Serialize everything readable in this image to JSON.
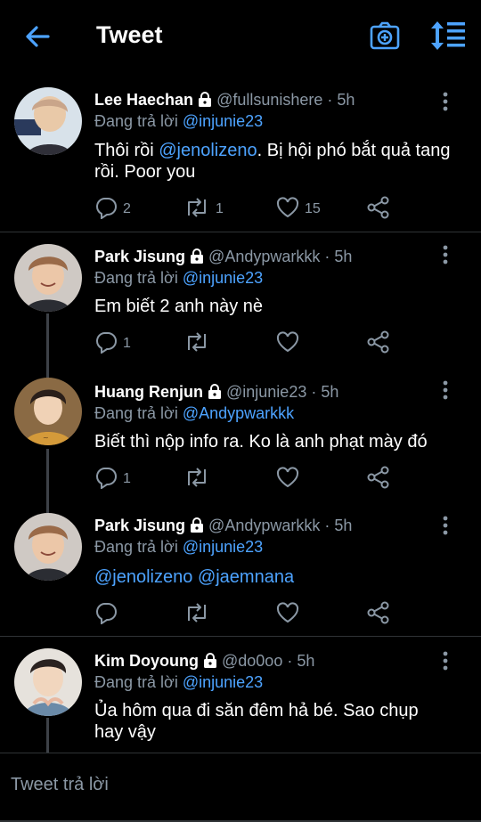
{
  "header": {
    "title": "Tweet"
  },
  "accent": "#4da3ff",
  "reply_bar": {
    "placeholder": "Tweet trả lời"
  },
  "tweets": [
    {
      "name": "Lee Haechan",
      "handle_time": "@fullsunishere · 5h",
      "reply_prefix": "Đang trả lời ",
      "reply_to": "@injunie23",
      "text_parts": [
        "Thôi rồi ",
        "@jenolizeno",
        ". Bị hội phó bắt quả tang rồi. Poor you"
      ],
      "replies": "2",
      "retweets": "1",
      "likes": "15"
    },
    {
      "name": "Park Jisung",
      "handle_time": "@Andypwarkkk · 5h",
      "reply_prefix": "Đang trả lời ",
      "reply_to": "@injunie23",
      "text": "Em biết 2 anh này nè",
      "replies": "1",
      "retweets": "",
      "likes": ""
    },
    {
      "name": "Huang Renjun",
      "handle_time": "@injunie23 · 5h",
      "reply_prefix": "Đang trả lời ",
      "reply_to": "@Andypwarkkk",
      "text": "Biết thì nộp info ra. Ko là anh phạt mày đó",
      "replies": "1",
      "retweets": "",
      "likes": ""
    },
    {
      "name": "Park Jisung",
      "handle_time": "@Andypwarkkk · 5h",
      "reply_prefix": "Đang trả lời ",
      "reply_to": "@injunie23",
      "text_parts": [
        "@jenolizeno",
        " ",
        "@jaemnana"
      ],
      "replies": "",
      "retweets": "",
      "likes": ""
    },
    {
      "name": "Kim Doyoung",
      "handle_time": "@do0oo · 5h",
      "reply_prefix": "Đang trả lời ",
      "reply_to": "@injunie23",
      "text": "Ủa hôm qua đi săn đêm hả bé. Sao chụp hay vậy"
    }
  ]
}
